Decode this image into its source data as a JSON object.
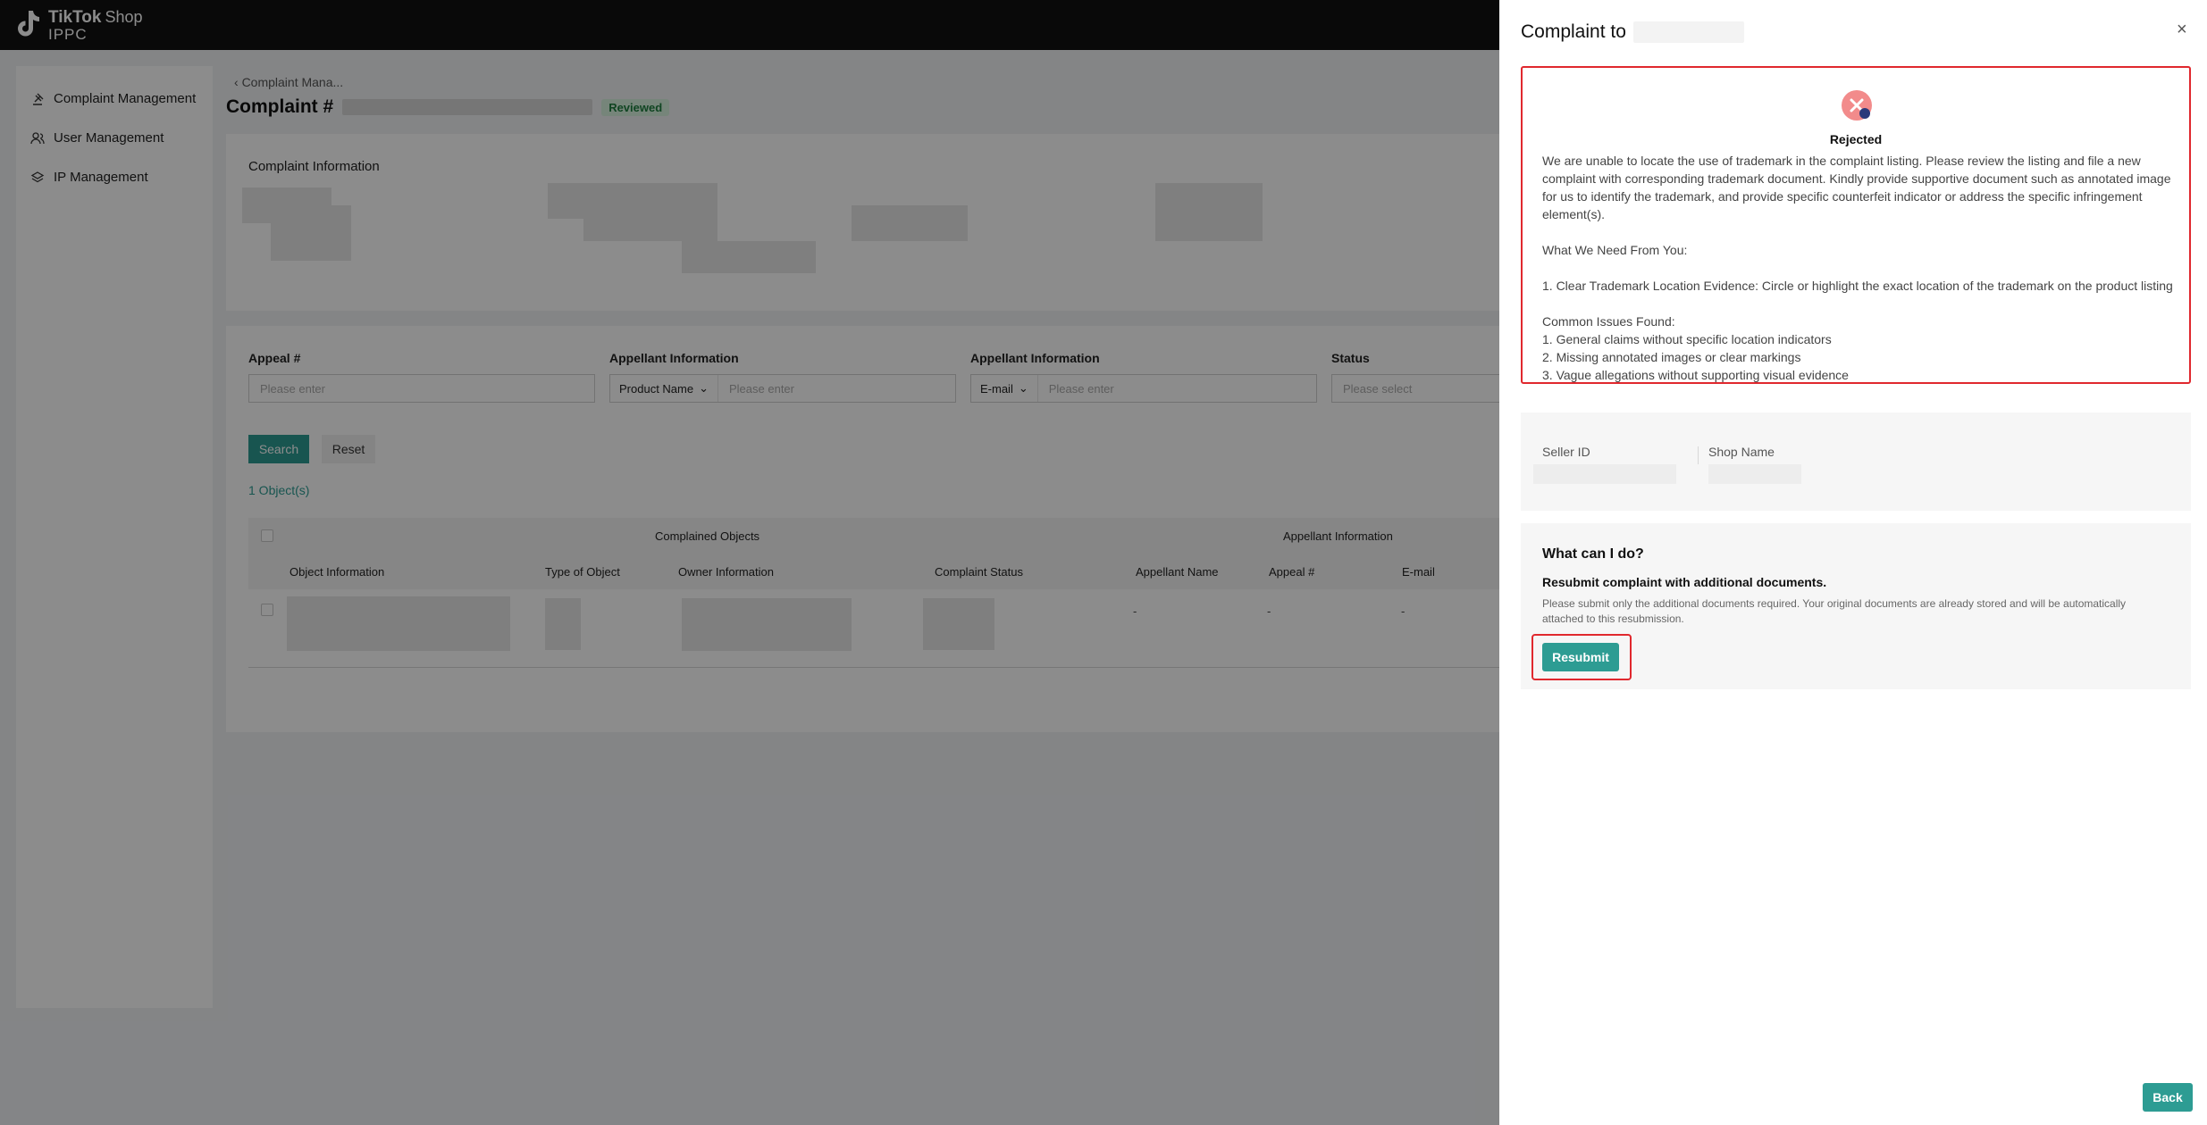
{
  "app": {
    "brand": "TikTok",
    "brand_suffix": "Shop",
    "brand_sub": "IPPC"
  },
  "sidebar": {
    "items": [
      {
        "label": "Complaint Management",
        "icon": "hammer-icon"
      },
      {
        "label": "User Management",
        "icon": "users-icon"
      },
      {
        "label": "IP Management",
        "icon": "layers-icon"
      }
    ]
  },
  "page": {
    "back_label": "Complaint Mana...",
    "title_prefix": "Complaint #",
    "status_badge": "Reviewed",
    "info_title": "Complaint Information"
  },
  "filters": {
    "appeal_label": "Appeal #",
    "appeal_placeholder": "Please enter",
    "appellant_label_1": "Appellant Information",
    "appellant_select_1": "Product Name",
    "appellant_placeholder_1": "Please enter",
    "appellant_label_2": "Appellant Information",
    "appellant_select_2": "E-mail",
    "appellant_placeholder_2": "Please enter",
    "status_label": "Status",
    "status_placeholder": "Please select",
    "search_label": "Search",
    "reset_label": "Reset",
    "object_count": "1 Object(s)"
  },
  "table": {
    "group_headers": [
      "Complained Objects",
      "Appellant Information"
    ],
    "columns": [
      "Object Information",
      "Type of Object",
      "Owner Information",
      "Complaint Status",
      "Appellant Name",
      "Appeal #",
      "E-mail"
    ],
    "row": {
      "appellant_name": "-",
      "appeal": "-",
      "email": "-"
    }
  },
  "drawer": {
    "title": "Complaint to",
    "close": "×",
    "rejection": {
      "status": "Rejected",
      "paragraph": "We are unable to locate the use of trademark in the complaint listing. Please review the listing and file a new complaint with corresponding trademark document. Kindly provide supportive document such as annotated image for us to identify the trademark, and provide specific counterfeit indicator or address the specific infringement element(s).",
      "need_heading": "What We Need From You:",
      "need_item": "1. Clear Trademark Location Evidence: Circle or highlight the exact location of the trademark on the product listing",
      "issues_heading": "Common Issues Found:",
      "issues": [
        "1. General claims without specific location indicators",
        "2. Missing annotated images or clear markings",
        "3. Vague allegations without supporting visual evidence"
      ]
    },
    "seller": {
      "seller_id_label": "Seller ID",
      "shop_name_label": "Shop Name"
    },
    "action": {
      "title": "What can I do?",
      "subtitle": "Resubmit complaint with additional documents.",
      "note": "Please submit only the additional documents required. Your original documents are already stored and will be automatically attached to this resubmission.",
      "resubmit_label": "Resubmit"
    },
    "back_label": "Back"
  },
  "colors": {
    "accent": "#2d9c93",
    "highlight_border": "#e0282e",
    "reviewed_text": "#1e7e3e",
    "topbar": "#121212"
  }
}
